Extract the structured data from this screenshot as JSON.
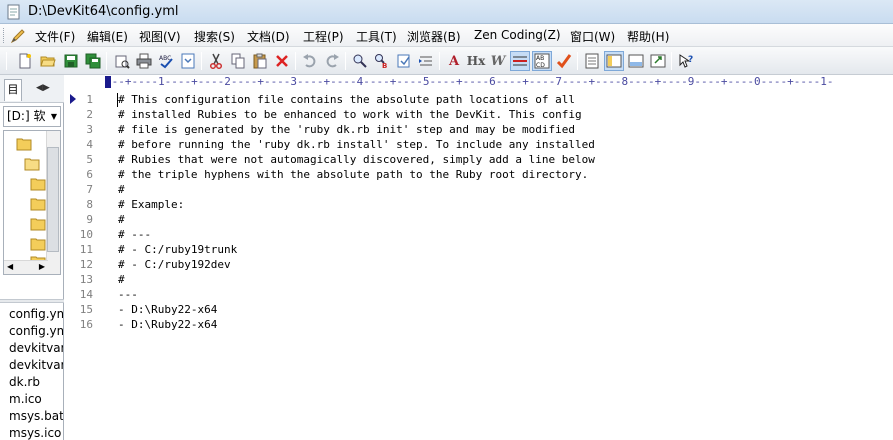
{
  "window": {
    "title": "D:\\DevKit64\\config.yml"
  },
  "menu": {
    "items": [
      "文件(F)",
      "编辑(E)",
      "视图(V)",
      "搜索(S)",
      "文档(D)",
      "工程(P)",
      "工具(T)",
      "浏览器(B)",
      "Zen Coding(Z)",
      "窗口(W)",
      "帮助(H)"
    ]
  },
  "toolbar": {
    "text_buttons": {
      "a_label": "A",
      "hx_label": "Hx",
      "w_label": "W"
    }
  },
  "sidebar": {
    "tab_label": "目",
    "drive_value": "[D:] 软",
    "files": [
      "config.yml",
      "config.yml",
      "devkitvars",
      "devkitvars",
      "dk.rb",
      "m.ico",
      "msys.bat",
      "msys.ico"
    ]
  },
  "editor": {
    "ruler": "---+----1----+----2----+----3----+----4----+----5----+----6----+----7----+----8----+----9----+----0----+----1-",
    "lines": [
      {
        "num": "1",
        "text": "# This configuration file contains the absolute path locations of all"
      },
      {
        "num": "2",
        "text": "# installed Rubies to be enhanced to work with the DevKit. This config"
      },
      {
        "num": "3",
        "text": "# file is generated by the 'ruby dk.rb init' step and may be modified"
      },
      {
        "num": "4",
        "text": "# before running the 'ruby dk.rb install' step. To include any installed"
      },
      {
        "num": "5",
        "text": "# Rubies that were not automagically discovered, simply add a line below"
      },
      {
        "num": "6",
        "text": "# the triple hyphens with the absolute path to the Ruby root directory."
      },
      {
        "num": "7",
        "text": "#"
      },
      {
        "num": "8",
        "text": "# Example:"
      },
      {
        "num": "9",
        "text": "#"
      },
      {
        "num": "10",
        "text": "# ---"
      },
      {
        "num": "11",
        "text": "# - C:/ruby19trunk"
      },
      {
        "num": "12",
        "text": "# - C:/ruby192dev"
      },
      {
        "num": "13",
        "text": "#"
      },
      {
        "num": "14",
        "text": "---"
      },
      {
        "num": "15",
        "text": "- D:\\Ruby22-x64"
      },
      {
        "num": "16",
        "text": "- D:\\Ruby22-x64"
      }
    ]
  }
}
